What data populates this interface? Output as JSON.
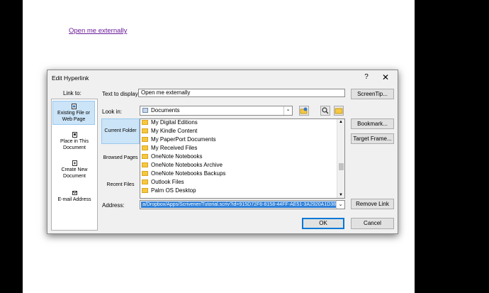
{
  "document": {
    "link_text": "Open me externally"
  },
  "dialog": {
    "title": "Edit Hyperlink",
    "help_glyph": "?",
    "close_glyph": "✕",
    "link_to_label": "Link to:",
    "link_to_items": [
      {
        "label": "Existing File or Web Page",
        "selected": true
      },
      {
        "label": "Place in This Document",
        "selected": false
      },
      {
        "label": "Create New Document",
        "selected": false
      },
      {
        "label": "E-mail Address",
        "selected": false
      }
    ],
    "text_to_display_label": "Text to display:",
    "text_to_display_value": "Open me externally",
    "screentip_label": "ScreenTip...",
    "look_in_label": "Look in:",
    "look_in_value": "Documents",
    "subnav": [
      {
        "label": "Current Folder",
        "selected": true
      },
      {
        "label": "Browsed Pages",
        "selected": false
      },
      {
        "label": "Recent Files",
        "selected": false
      }
    ],
    "files": [
      "My Digital Editions",
      "My Kindle Content",
      "My PaperPort Documents",
      "My Received Files",
      "OneNote Notebooks",
      "OneNote Notebooks Archive",
      "OneNote Notebooks Backups",
      "Outlook Files",
      "Palm OS Desktop"
    ],
    "bookmark_label": "Bookmark...",
    "target_frame_label": "Target Frame...",
    "address_label": "Address:",
    "address_value": "a/Dropbox/Apps/Scrivener/Tutorial.scriv?id=915D72F6-8158-44FF-AE51-3A2920A1D383",
    "remove_link_label": "Remove Link",
    "ok_label": "OK",
    "cancel_label": "Cancel"
  }
}
